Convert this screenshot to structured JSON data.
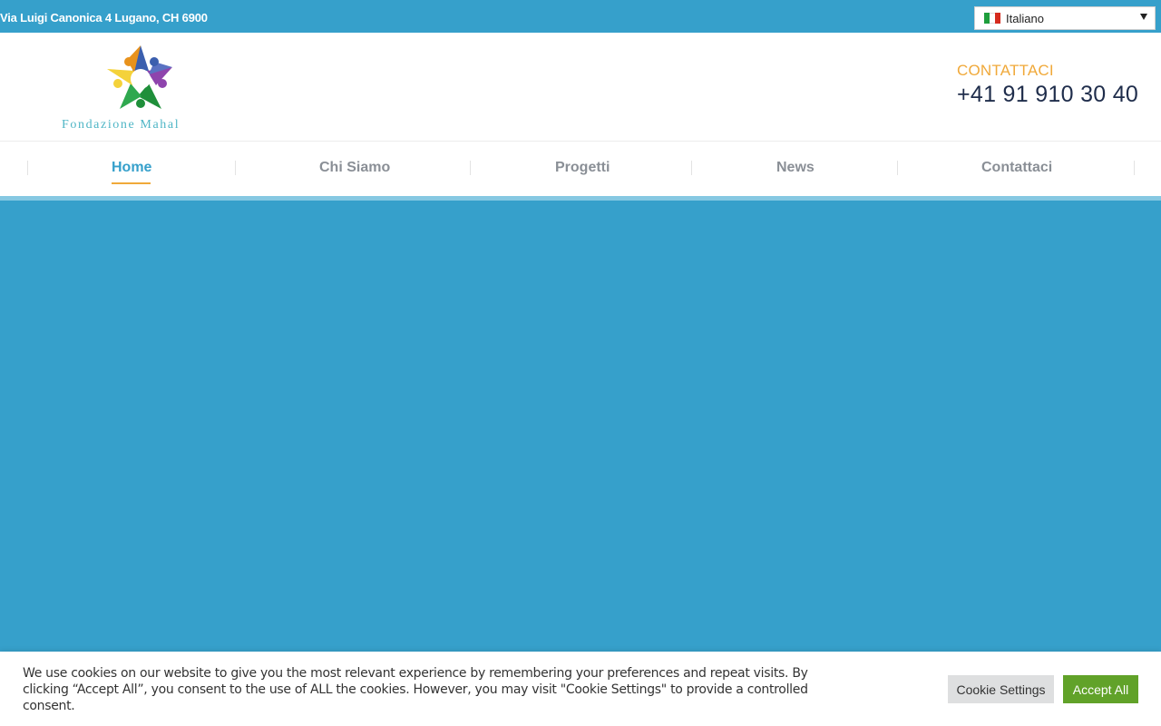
{
  "topbar": {
    "address": "Via Luigi Canonica 4 Lugano, CH 6900",
    "language": {
      "selected": "Italiano",
      "flag_icon": "italy-flag-icon"
    }
  },
  "header": {
    "logo_text": "Fondazione Mahal",
    "contact_label": "CONTATTACI",
    "phone": "+41 91 910 30 40"
  },
  "nav": {
    "items": [
      {
        "label": "Home",
        "active": true
      },
      {
        "label": "Chi Siamo",
        "active": false
      },
      {
        "label": "Progetti",
        "active": false
      },
      {
        "label": "News",
        "active": false
      },
      {
        "label": "Contattaci",
        "active": false
      }
    ]
  },
  "cookie": {
    "message": "We use cookies on our website to give you the most relevant experience by remembering your preferences and repeat visits. By clicking “Accept All”, you consent to the use of ALL the cookies. However, you may visit \"Cookie Settings\" to provide a controlled consent.",
    "settings_label": "Cookie Settings",
    "accept_label": "Accept All"
  },
  "colors": {
    "primary": "#36a0cb",
    "accent": "#f0a93a",
    "accept_button": "#61a229"
  }
}
